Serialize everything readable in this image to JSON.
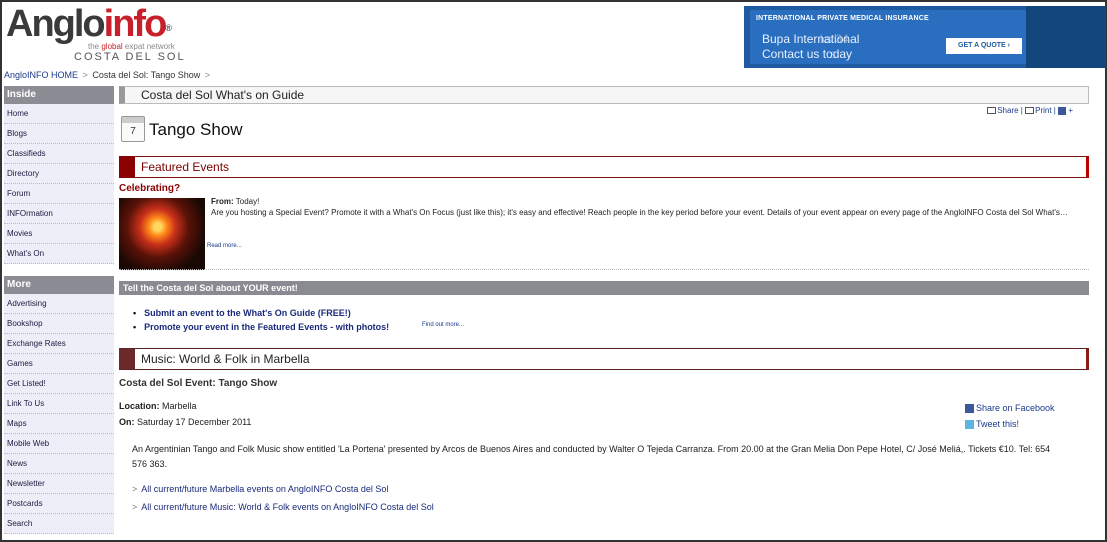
{
  "logo": {
    "main_angl": "Anglo",
    "main_info": "info",
    "reg": "®",
    "tag_prefix": "the ",
    "tag_global": "global",
    "tag_suffix": " expat network",
    "region": "COSTA DEL SOL"
  },
  "ad": {
    "head": "INTERNATIONAL PRIVATE MEDICAL INSURANCE",
    "line1": "Bupa International",
    "line2": "Contact us today",
    "ghost1": "ks 34",
    "ghost2": "s",
    "button": "GET A QUOTE ›"
  },
  "breadcrumb": {
    "home": "AngloINFO HOME",
    "current": "Costa del Sol: Tango Show",
    "sep": ">"
  },
  "sidebar": {
    "inside_title": "Inside",
    "inside_items": [
      "Home",
      "Blogs",
      "Classifieds",
      "Directory",
      "Forum",
      "INFOrmation",
      "Movies",
      "What's On"
    ],
    "more_title": "More",
    "more_items": [
      "Advertising",
      "Bookshop",
      "Exchange Rates",
      "Games",
      "Get Listed!",
      "Link To Us",
      "Maps",
      "Mobile Web",
      "News",
      "Newsletter",
      "Postcards",
      "Search"
    ]
  },
  "main": {
    "guide_title": "Costa del Sol What's on Guide",
    "tools": {
      "share": "Share",
      "print": "Print",
      "plus": "+"
    },
    "calendar_day": "7",
    "page_title": "Tango Show",
    "featured_title": "Featured Events",
    "celebrating": "Celebrating?",
    "from_label": "From:",
    "from_value": "Today!",
    "featured_text": "Are you hosting a Special Event? Promote it with a What's On Focus (just like this); it's easy and effective! Reach people in the key period before your event. Details of your event appear on every page of the AngloINFO Costa del Sol What's…",
    "read_more": "Read more...",
    "tell_title": "Tell the Costa del Sol about YOUR event!",
    "tell_items": [
      "Submit an event to the What's On Guide (FREE!)",
      "Promote your event in the Featured Events - with photos!"
    ],
    "find_out": "Find out more...",
    "category_title": "Music: World & Folk in Marbella",
    "event_heading": "Costa del Sol Event: Tango Show",
    "location_label": "Location:",
    "location_value": "Marbella",
    "on_label": "On:",
    "on_value": "Saturday 17 December 2011",
    "share_facebook": "Share on Facebook",
    "tweet": "Tweet this!",
    "description": "An Argentinian Tango and Folk Music show entitled 'La Portena' presented by Arcos de Buenos Aires and conducted by Walter O Tejeda Carranza. From 20.00 at the Gran Melia Don Pepe Hotel, C/ José Meliá,. Tickets €10. Tel: 654 576 363.",
    "link1": "All current/future Marbella events on AngloINFO Costa del Sol",
    "link2": "All current/future Music: World & Folk events on AngloINFO Costa del Sol",
    "link_prefix": ">"
  },
  "colors": {
    "accent": "#8b0000",
    "link": "#1a3a8a",
    "sidebar_head": "#8c8c94",
    "ad_bg": "#1e5aa0"
  }
}
